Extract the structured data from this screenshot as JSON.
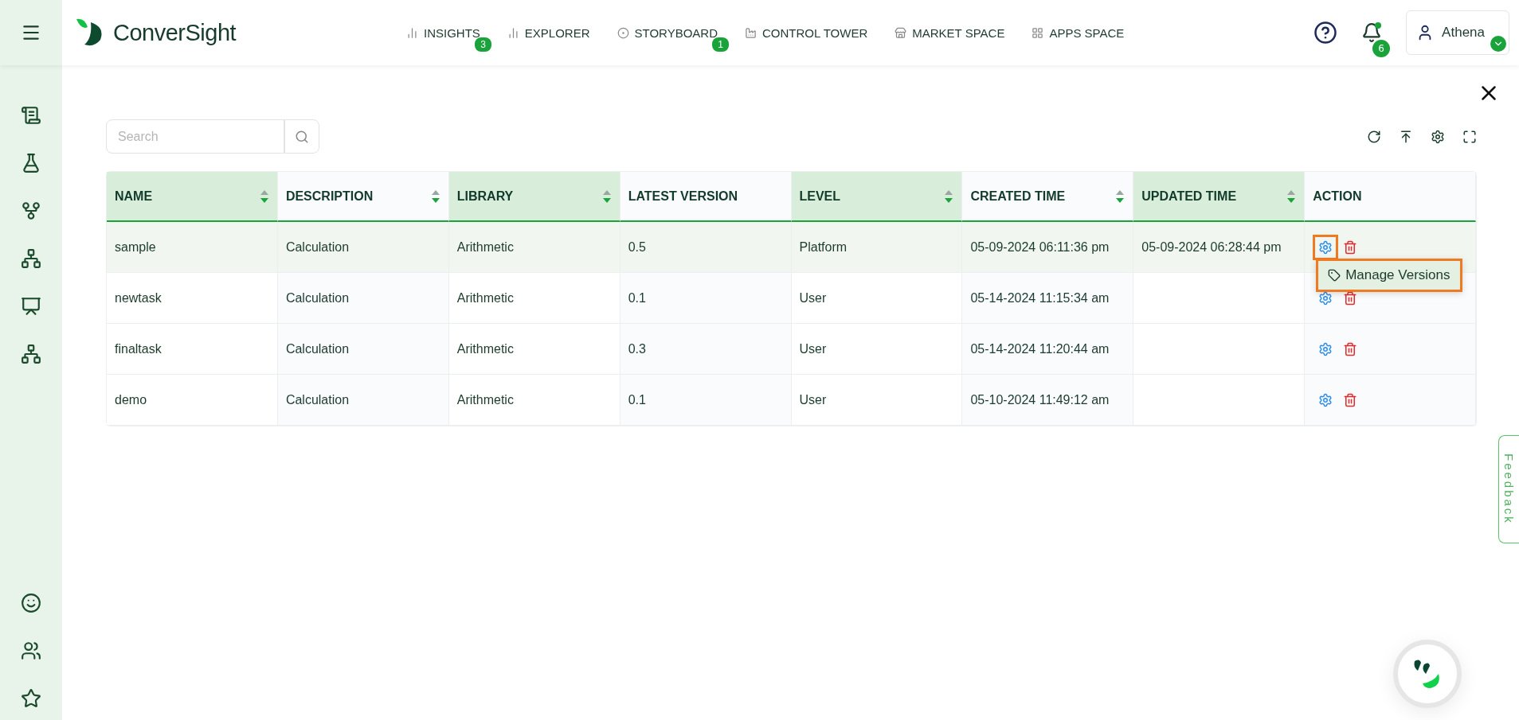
{
  "brand": {
    "name": "ConverSight"
  },
  "nav": [
    {
      "label": "INSIGHTS",
      "badge": "3"
    },
    {
      "label": "EXPLORER"
    },
    {
      "label": "STORYBOARD",
      "badge": "1"
    },
    {
      "label": "CONTROL TOWER"
    },
    {
      "label": "MARKET SPACE"
    },
    {
      "label": "APPS SPACE"
    }
  ],
  "notifications": {
    "badge": "6"
  },
  "user": {
    "name": "Athena"
  },
  "search": {
    "placeholder": "Search"
  },
  "table": {
    "columns": [
      {
        "label": "NAME",
        "sortable": true
      },
      {
        "label": "DESCRIPTION",
        "sortable": true
      },
      {
        "label": "LIBRARY",
        "sortable": true
      },
      {
        "label": "LATEST VERSION",
        "sortable": false
      },
      {
        "label": "LEVEL",
        "sortable": true
      },
      {
        "label": "CREATED TIME",
        "sortable": true
      },
      {
        "label": "UPDATED TIME",
        "sortable": true
      },
      {
        "label": "ACTION",
        "sortable": false
      }
    ],
    "rows": [
      {
        "selected": true,
        "cells": [
          "sample",
          "Calculation",
          "Arithmetic",
          "0.5",
          "Platform",
          "05-09-2024 06:11:36 pm",
          "05-09-2024 06:28:44 pm"
        ],
        "menu": {
          "items": [
            "Manage Versions"
          ]
        }
      },
      {
        "selected": false,
        "cells": [
          "newtask",
          "Calculation",
          "Arithmetic",
          "0.1",
          "User",
          "05-14-2024 11:15:34 am",
          ""
        ]
      },
      {
        "selected": false,
        "cells": [
          "finaltask",
          "Calculation",
          "Arithmetic",
          "0.3",
          "User",
          "05-14-2024 11:20:44 am",
          ""
        ]
      },
      {
        "selected": false,
        "cells": [
          "demo",
          "Calculation",
          "Arithmetic",
          "0.1",
          "User",
          "05-10-2024 11:49:12 am",
          ""
        ]
      }
    ]
  },
  "feedback": {
    "label": "Feedback"
  }
}
